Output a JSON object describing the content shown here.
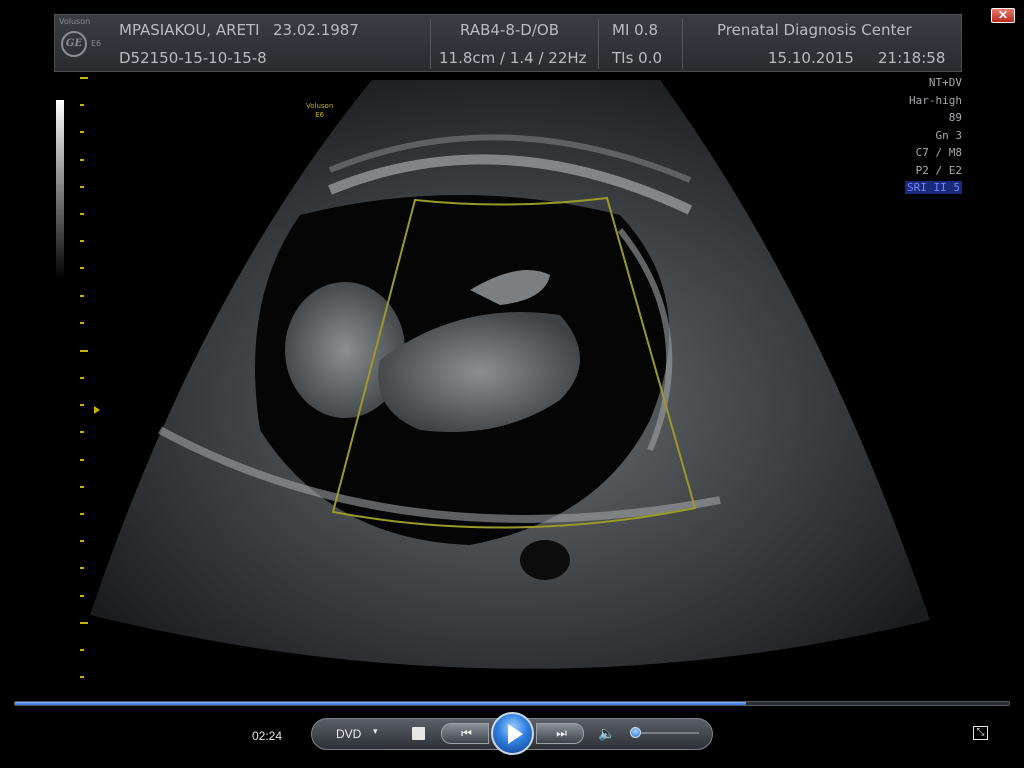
{
  "window": {
    "close_label": "✕"
  },
  "ultrasound": {
    "patient_name": "MPASIAKOU, ARETI",
    "birth_date": "23.02.1987",
    "patient_id": "D52150-15-10-15-8",
    "probe": "RAB4-8-D/OB",
    "probe_settings": "11.8cm / 1.4 / 22Hz",
    "mi": "MI  0.8",
    "tis": "TIs  0.0",
    "institution": "Prenatal Diagnosis Center",
    "date": "15.10.2015",
    "time": "21:18:58",
    "brand_top": "Voluson",
    "brand_side": "E6",
    "logo_text": "GE",
    "zoom_label_line1": "Voluson",
    "zoom_label_line2": "E6",
    "params": [
      {
        "text": "NT+DV",
        "highlight": false
      },
      {
        "text": "Har-high",
        "highlight": false
      },
      {
        "text": "89",
        "highlight": false
      },
      {
        "text": "Gn  3",
        "highlight": false
      },
      {
        "text": "C7 / M8",
        "highlight": false
      },
      {
        "text": "P2 / E2",
        "highlight": false
      },
      {
        "text": "SRI II 5",
        "highlight": true
      }
    ]
  },
  "player": {
    "elapsed": "02:24",
    "progress": 0.735,
    "source": "DVD",
    "source_arrow": "▾",
    "prev_symbol": "⏮",
    "next_symbol": "⏭",
    "volume_symbol": "🔈",
    "volume_level": 0.03,
    "fullscreen_symbol": "⤡"
  },
  "colors": {
    "accent": "#2f7fe0",
    "caliper": "#9a9a2a",
    "highlight": "#6f86ff"
  }
}
